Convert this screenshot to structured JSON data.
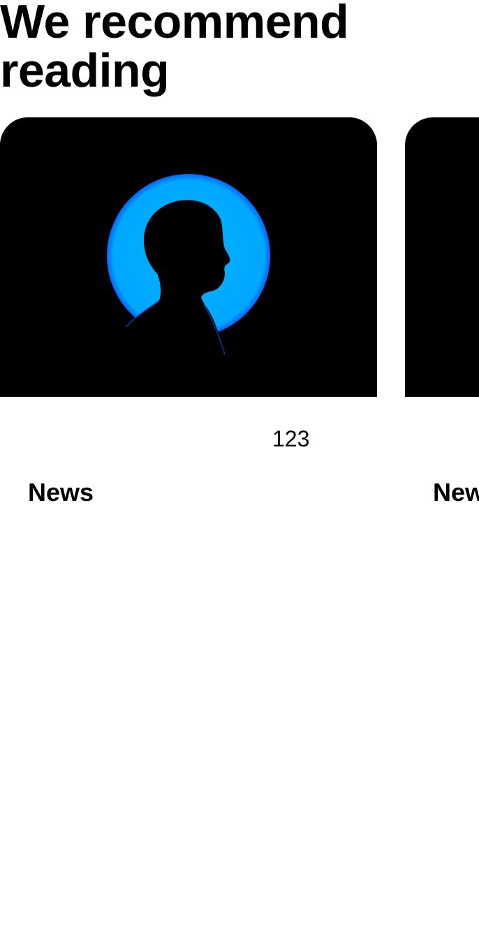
{
  "section": {
    "title": "We recommend reading"
  },
  "cards": [
    {
      "image": "silhouette-portrait-blue-circle",
      "count": "123",
      "category": "News"
    },
    {
      "image": "dark-image",
      "count": "",
      "category": "News"
    }
  ],
  "colors": {
    "image_background": "#000000",
    "accent_circle": "#00aaff",
    "text": "#000000",
    "page_background": "#ffffff"
  }
}
